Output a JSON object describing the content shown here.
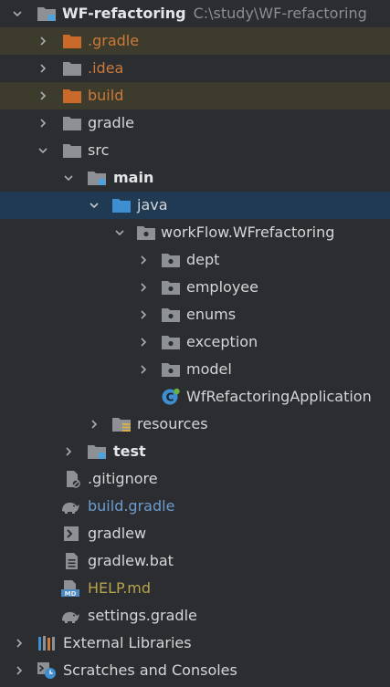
{
  "tree": {
    "root": {
      "label": "WF-refactoring",
      "path": "C:\\study\\WF-refactoring"
    },
    "gradle_hidden": ".gradle",
    "idea": ".idea",
    "build": "build",
    "gradle": "gradle",
    "src": "src",
    "main": "main",
    "java": "java",
    "package": "workFlow.WFrefactoring",
    "dept": "dept",
    "employee": "employee",
    "enums": "enums",
    "exception": "exception",
    "model": "model",
    "app_class": "WfRefactoringApplication",
    "resources": "resources",
    "test": "test",
    "gitignore": ".gitignore",
    "build_gradle": "build.gradle",
    "gradlew": "gradlew",
    "gradlew_bat": "gradlew.bat",
    "help": "HELP.md",
    "settings": "settings.gradle",
    "external_libraries": "External Libraries",
    "scratches": "Scratches and Consoles"
  },
  "colors": {
    "background": "#2b2d30",
    "selected_row": "#1f3a52",
    "excluded_row": "#3d3b2c",
    "excluded_text": "#cc7a3b",
    "modified_text": "#6d9ccf",
    "untracked_text": "#b8a44a"
  }
}
